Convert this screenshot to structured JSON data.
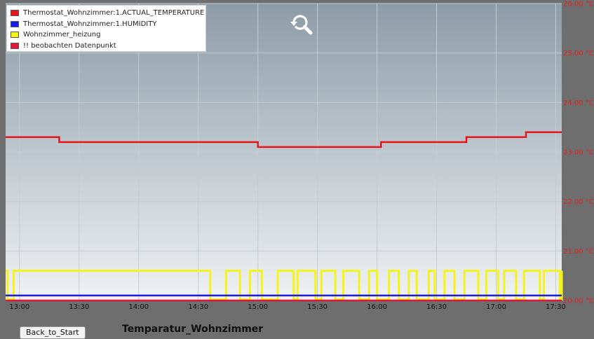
{
  "chart_data": {
    "type": "line",
    "x_ticks": [
      "13:00",
      "13:30",
      "14:00",
      "14:30",
      "15:00",
      "15:30",
      "16:00",
      "16:30",
      "17:00",
      "17:30"
    ],
    "x_range": [
      "12:53",
      "17:33"
    ],
    "y_ticks": [
      "20.00 °C",
      "21.00 °C",
      "22.00 °C",
      "23.00 °C",
      "24.00 °C",
      "25.00 °C",
      "26.00 °C"
    ],
    "y_range": [
      20,
      26
    ],
    "y_axis_position": "right",
    "grid": true,
    "legend_position": "top-left",
    "series": [
      {
        "name": "Thermostat_Wohnzimmer:1.ACTUAL_TEMPERATURE",
        "color": "#e8161a",
        "step": true,
        "points": [
          [
            "12:53",
            23.3
          ],
          [
            "13:20",
            23.2
          ],
          [
            "15:00",
            23.1
          ],
          [
            "16:02",
            23.2
          ],
          [
            "16:45",
            23.3
          ],
          [
            "17:15",
            23.4
          ],
          [
            "17:33",
            23.4
          ]
        ]
      },
      {
        "name": "Thermostat_Wohnzimmer:1.HUMIDITY",
        "color": "#1a1ae8",
        "step": true,
        "points": [
          [
            "12:53",
            20.1
          ],
          [
            "17:33",
            20.1
          ]
        ]
      },
      {
        "name": "Wohnzimmer_heizung",
        "color": "#f4f41c",
        "step": true,
        "on_value": 20.6,
        "off_value": 20.02,
        "points": [
          [
            "12:53",
            20.6
          ],
          [
            "12:54",
            20.02
          ],
          [
            "12:57",
            20.6
          ],
          [
            "14:36",
            20.02
          ],
          [
            "14:44",
            20.6
          ],
          [
            "14:51",
            20.02
          ],
          [
            "14:56",
            20.6
          ],
          [
            "15:02",
            20.02
          ],
          [
            "15:10",
            20.6
          ],
          [
            "15:18",
            20.02
          ],
          [
            "15:20",
            20.6
          ],
          [
            "15:29",
            20.02
          ],
          [
            "15:32",
            20.6
          ],
          [
            "15:39",
            20.02
          ],
          [
            "15:43",
            20.6
          ],
          [
            "15:51",
            20.02
          ],
          [
            "15:56",
            20.6
          ],
          [
            "16:00",
            20.02
          ],
          [
            "16:06",
            20.6
          ],
          [
            "16:11",
            20.02
          ],
          [
            "16:16",
            20.6
          ],
          [
            "16:20",
            20.02
          ],
          [
            "16:26",
            20.6
          ],
          [
            "16:29",
            20.02
          ],
          [
            "16:34",
            20.6
          ],
          [
            "16:39",
            20.02
          ],
          [
            "16:44",
            20.6
          ],
          [
            "16:51",
            20.02
          ],
          [
            "16:55",
            20.6
          ],
          [
            "17:01",
            20.02
          ],
          [
            "17:04",
            20.6
          ],
          [
            "17:10",
            20.02
          ],
          [
            "17:14",
            20.6
          ],
          [
            "17:22",
            20.02
          ],
          [
            "17:24",
            20.6
          ],
          [
            "17:32",
            20.02
          ],
          [
            "17:33",
            20.6
          ]
        ]
      },
      {
        "name": "!! beobachten Datenpunkt",
        "color": "#e0163a",
        "step": true,
        "points": [
          [
            "12:53",
            20.0
          ],
          [
            "17:33",
            20.0
          ]
        ]
      }
    ]
  },
  "footer": {
    "back_button_label": "Back_to_Start",
    "title": "Temparatur_Wohnzimmer"
  },
  "icons": {
    "zoom": "zoom-reset-icon"
  },
  "colors": {
    "background": "#6e6e6e",
    "plot_top": "#8c9ca8",
    "plot_bottom": "#f0f2f4",
    "grid": "#c4ccd2",
    "axis_labels": "#e82020"
  }
}
